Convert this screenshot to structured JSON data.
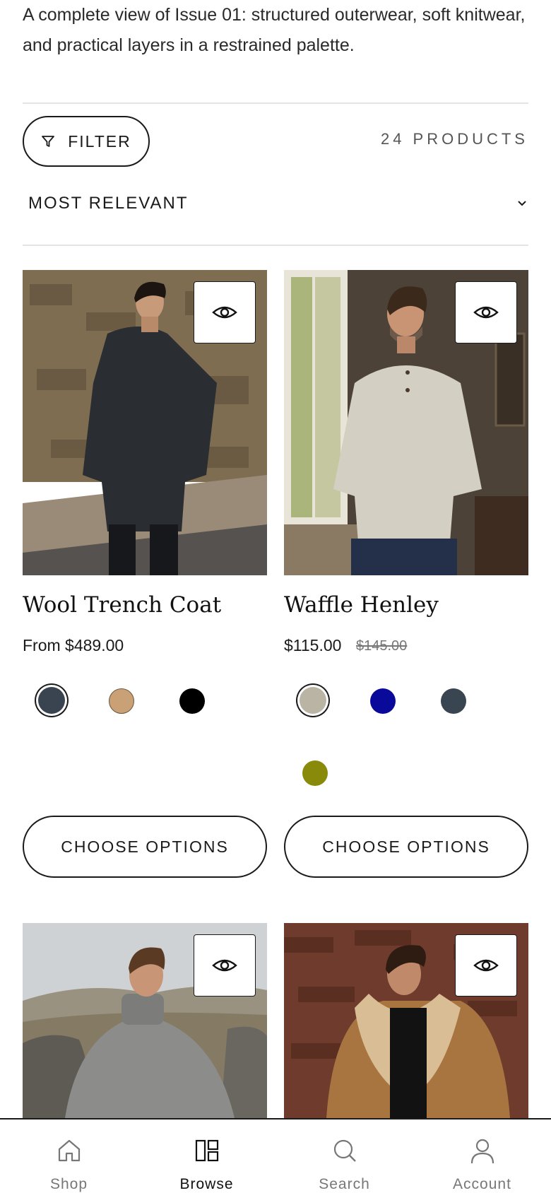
{
  "intro": {
    "text": "A complete view of Issue 01: structured outerwear, soft knitwear, and practical layers in a restrained palette."
  },
  "toolbar": {
    "filter_label": "FILTER",
    "product_count": "24 PRODUCTS",
    "sort_label": "MOST RELEVANT"
  },
  "products": [
    {
      "name": "Wool Trench Coat",
      "price": "From $489.00",
      "compare_price": "",
      "swatches": [
        "#3a4350",
        "#caa077",
        "#000000"
      ],
      "selected_swatch": 0,
      "cta_label": "CHOOSE OPTIONS",
      "image": "man-in-charcoal-wool-trench-coat-by-stone-wall"
    },
    {
      "name": "Waffle Henley",
      "price": "$115.00",
      "compare_price": "$145.00",
      "swatches": [
        "#bab4a4",
        "#0a0a9a",
        "#3a4552",
        "#8a8a0a"
      ],
      "selected_swatch": 0,
      "cta_label": "CHOOSE OPTIONS",
      "image": "man-in-oatmeal-waffle-henley-by-window"
    },
    {
      "image": "man-in-grey-roll-neck-knit-on-moorland"
    },
    {
      "image": "man-in-tan-shearling-jacket-by-brick-wall"
    }
  ],
  "tabbar": {
    "items": [
      {
        "label": "Shop",
        "icon": "home-icon"
      },
      {
        "label": "Browse",
        "icon": "grid-icon"
      },
      {
        "label": "Search",
        "icon": "search-icon"
      },
      {
        "label": "Account",
        "icon": "user-icon"
      }
    ],
    "active": "Browse"
  }
}
